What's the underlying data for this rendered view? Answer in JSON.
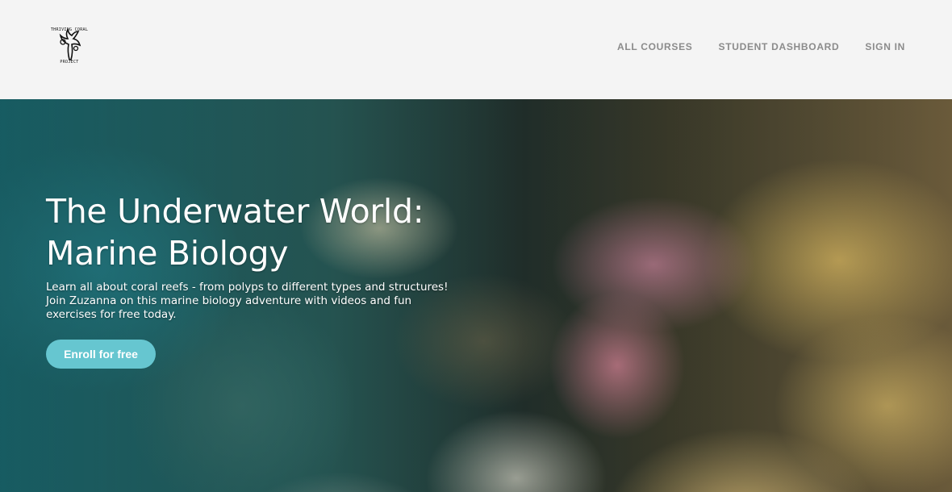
{
  "header": {
    "logo": {
      "top_text": "THRIVING CORAL",
      "bottom_text": "PROJECT"
    },
    "nav": {
      "all_courses": "ALL COURSES",
      "student_dashboard": "STUDENT DASHBOARD",
      "sign_in": "SIGN IN"
    }
  },
  "hero": {
    "title_line1": "The Underwater World:",
    "title_line2": "Marine Biology",
    "description": "Learn all about coral reefs - from polyps to different types and structures! Join Zuzanna on this marine biology adventure with videos and fun exercises for free today.",
    "cta_label": "Enroll for free",
    "cta_color": "#66c6d0"
  }
}
